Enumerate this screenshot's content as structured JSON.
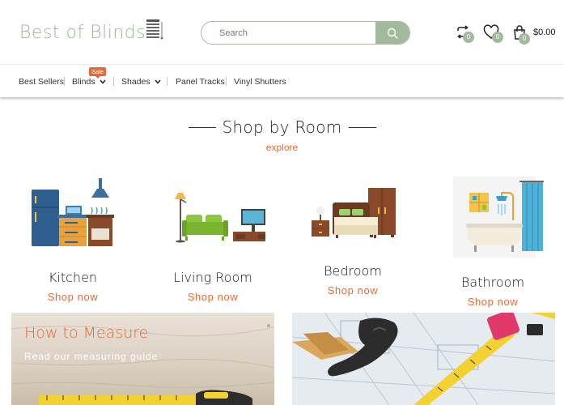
{
  "header": {
    "logo_text": "Best of Blinds",
    "search_placeholder": "Search",
    "compare_count": "0",
    "wishlist_count": "0",
    "cart_count": "0",
    "cart_total": "$0.00"
  },
  "nav": {
    "items": [
      {
        "label": "Best Sellers"
      },
      {
        "label": "Blinds",
        "badge": "Sale"
      },
      {
        "label": "Shades"
      },
      {
        "label": "Panel Tracks"
      },
      {
        "label": "Vinyl Shutters"
      }
    ]
  },
  "rooms_section": {
    "title": "Shop by Room",
    "subtitle": "explore",
    "rooms": [
      {
        "name": "Kitchen",
        "link": "Shop now"
      },
      {
        "name": "Living Room",
        "link": "Shop now"
      },
      {
        "name": "Bedroom",
        "link": "Shop now"
      },
      {
        "name": "Bathroom",
        "link": "Shop now"
      }
    ]
  },
  "banners": {
    "measure": {
      "title": "How to Measure",
      "subtitle": "Read our measuring guide"
    }
  },
  "colors": {
    "accent_green": "#a3b99c",
    "accent_orange": "#e36c3a"
  }
}
